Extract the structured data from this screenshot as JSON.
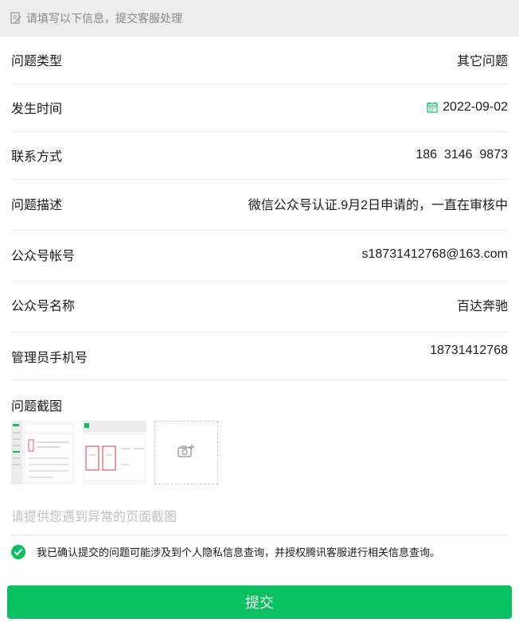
{
  "notice": {
    "text": "请填写以下信息，提交客服处理",
    "icon": "edit-icon"
  },
  "fields": [
    {
      "label": "问题类型",
      "value": "其它问题"
    },
    {
      "label": "发生时间",
      "value": "2022-09-02",
      "icon": "calendar-icon"
    },
    {
      "label": "联系方式",
      "value": "186  3146  9873"
    },
    {
      "label": "问题描述",
      "value": "微信公众号认证.9月2日申请的，一直在审核中"
    },
    {
      "label": "公众号帐号",
      "value": "s18731412768@163.com"
    },
    {
      "label": "公众号名称",
      "value": "百达奔驰"
    },
    {
      "label": "管理员手机号",
      "value": "18731412768"
    }
  ],
  "screenshots": {
    "label": "问题截图",
    "upload_icon": "camera-add-icon"
  },
  "description_placeholder": "请提供您遇到异常的页面截图",
  "consent": {
    "text": "我已确认提交的问题可能涉及到个人隐私信息查询，并授权腾讯客服进行相关信息查询。",
    "checked": true
  },
  "submit_label": "提交",
  "colors": {
    "accent": "#07c160",
    "notice_bg": "#ededed",
    "placeholder": "#c2c2c2"
  }
}
